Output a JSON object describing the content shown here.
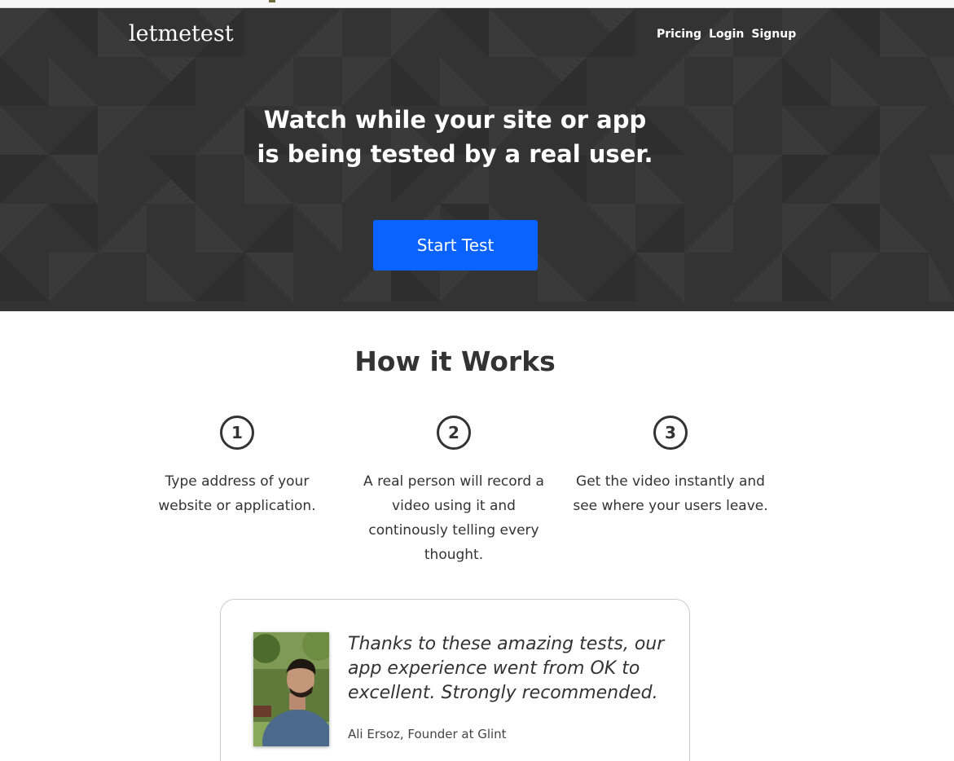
{
  "header": {
    "logo": "letmetest",
    "nav": [
      "Pricing",
      "Login",
      "Signup"
    ]
  },
  "hero": {
    "title_line1": "Watch while your site or app",
    "title_line2": "is being tested by a real user.",
    "cta_label": "Start Test"
  },
  "how": {
    "title": "How it Works",
    "steps": [
      {
        "number": "1",
        "text": "Type address of your website or application."
      },
      {
        "number": "2",
        "text": "A real person will record a video using it and continously telling every thought."
      },
      {
        "number": "3",
        "text": "Get the video instantly and see where your users leave."
      }
    ]
  },
  "testimonial": {
    "quote": "Thanks to these amazing tests, our app experience went from OK to excellent. Strongly recommended.",
    "author": "Ali Ersoz, Founder at Glint"
  },
  "colors": {
    "hero_bg": "#333333",
    "accent": "#0a63ff",
    "text": "#333333"
  }
}
